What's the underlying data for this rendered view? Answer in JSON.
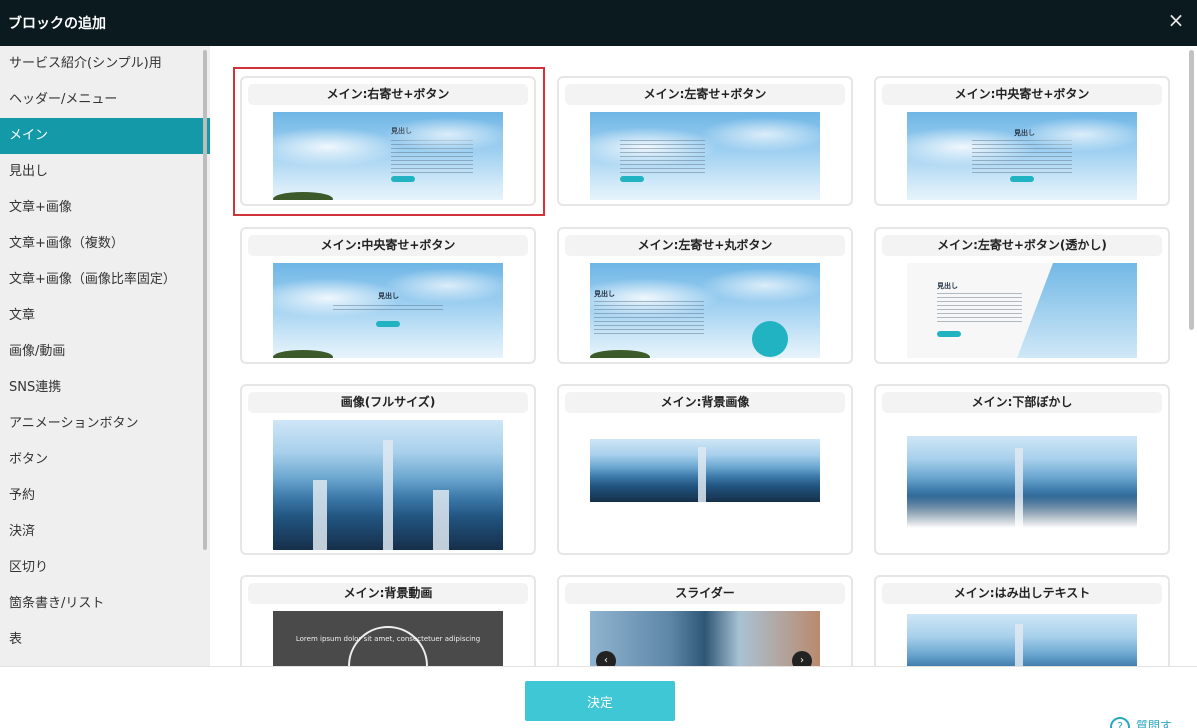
{
  "header": {
    "title": "ブロックの追加",
    "close_icon": "×"
  },
  "sidebar": {
    "items": [
      {
        "label": "サービス紹介(シンプル)用"
      },
      {
        "label": "ヘッダー/メニュー"
      },
      {
        "label": "メイン",
        "active": true
      },
      {
        "label": "見出し"
      },
      {
        "label": "文章+画像"
      },
      {
        "label": "文章+画像（複数）"
      },
      {
        "label": "文章+画像（画像比率固定）"
      },
      {
        "label": "文章"
      },
      {
        "label": "画像/動画"
      },
      {
        "label": "SNS連携"
      },
      {
        "label": "アニメーションボタン"
      },
      {
        "label": "ボタン"
      },
      {
        "label": "予約"
      },
      {
        "label": "決済"
      },
      {
        "label": "区切り"
      },
      {
        "label": "箇条書き/リスト"
      },
      {
        "label": "表"
      }
    ]
  },
  "cards": [
    {
      "title": "メイン:右寄せ+ボタン",
      "thumb_heading": "見出し",
      "selected": true
    },
    {
      "title": "メイン:左寄せ+ボタン"
    },
    {
      "title": "メイン:中央寄せ+ボタン",
      "thumb_heading": "見出し"
    },
    {
      "title": "メイン:中央寄せ+ボタン",
      "thumb_heading": "見出し"
    },
    {
      "title": "メイン:左寄せ+丸ボタン",
      "thumb_heading": "見出し"
    },
    {
      "title": "メイン:左寄せ+ボタン(透かし)",
      "thumb_heading": "見出し"
    },
    {
      "title": "画像(フルサイズ)"
    },
    {
      "title": "メイン:背景画像"
    },
    {
      "title": "メイン:下部ぼかし"
    },
    {
      "title": "メイン:背景動画",
      "thumb_text": "Lorem ipsum dolor sit amet, consectetuer adipiscing"
    },
    {
      "title": "スライダー"
    },
    {
      "title": "メイン:はみ出しテキスト"
    }
  ],
  "footer": {
    "decide_label": "決定",
    "help_label": "質問す"
  },
  "colors": {
    "accent": "#1399a8",
    "button": "#3fc7d5",
    "selected_border": "#d0343a",
    "header_bg": "#0a1a1f"
  }
}
